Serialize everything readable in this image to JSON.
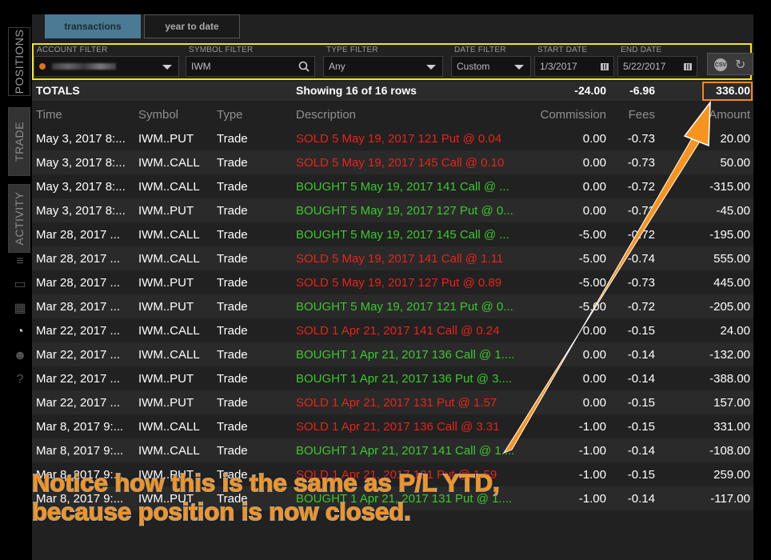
{
  "sidenav": {
    "tabs": [
      {
        "label": "POSITIONS",
        "active": true
      },
      {
        "label": "TRADE",
        "active": false
      },
      {
        "label": "ACTIVITY",
        "active": false
      }
    ],
    "icons": [
      "list-icon",
      "tv-icon",
      "chart-icon",
      "monitor-icon",
      "people-icon",
      "help-icon"
    ]
  },
  "tabs": {
    "transactions": "transactions",
    "ytd": "year to date"
  },
  "filters": {
    "account_label": "ACCOUNT FILTER",
    "symbol_label": "SYMBOL FILTER",
    "symbol_value": "IWM",
    "type_label": "TYPE FILTER",
    "type_value": "Any",
    "date_label": "DATE FILTER",
    "date_value": "Custom",
    "start_label": "START DATE",
    "start_value": "1/3/2017",
    "end_label": "END DATE",
    "end_value": "5/22/2017",
    "csv_label": "CSV"
  },
  "totals": {
    "label": "TOTALS",
    "showing": "Showing 16 of 16 rows",
    "commission": "-24.00",
    "fees": "-6.96",
    "amount": "336.00"
  },
  "columns": {
    "time": "Time",
    "symbol": "Symbol",
    "type": "Type",
    "description": "Description",
    "commission": "Commission",
    "fees": "Fees",
    "amount": "Amount"
  },
  "rows": [
    {
      "time": "May 3, 2017   8:...",
      "symbol": "IWM..PUT",
      "type": "Trade",
      "desc": "SOLD 5 May 19, 2017 121 Put @ 0.04",
      "side": "sold",
      "com": "0.00",
      "fee": "-0.73",
      "amt": "20.00"
    },
    {
      "time": "May 3, 2017   8:...",
      "symbol": "IWM..CALL",
      "type": "Trade",
      "desc": "SOLD 5 May 19, 2017 145 Call @ 0.10",
      "side": "sold",
      "com": "0.00",
      "fee": "-0.73",
      "amt": "50.00"
    },
    {
      "time": "May 3, 2017   8:...",
      "symbol": "IWM..CALL",
      "type": "Trade",
      "desc": "BOUGHT 5 May 19, 2017 141 Call @ ...",
      "side": "bought",
      "com": "0.00",
      "fee": "-0.72",
      "amt": "-315.00"
    },
    {
      "time": "May 3, 2017   8:...",
      "symbol": "IWM..PUT",
      "type": "Trade",
      "desc": "BOUGHT 5 May 19, 2017 127 Put @ 0...",
      "side": "bought",
      "com": "0.00",
      "fee": "-0.72",
      "amt": "-45.00"
    },
    {
      "time": "Mar 28, 2017   ...",
      "symbol": "IWM..CALL",
      "type": "Trade",
      "desc": "BOUGHT 5 May 19, 2017 145 Call @ ...",
      "side": "bought",
      "com": "-5.00",
      "fee": "-0.72",
      "amt": "-195.00"
    },
    {
      "time": "Mar 28, 2017   ...",
      "symbol": "IWM..CALL",
      "type": "Trade",
      "desc": "SOLD 5 May 19, 2017 141 Call @ 1.11",
      "side": "sold",
      "com": "-5.00",
      "fee": "-0.74",
      "amt": "555.00"
    },
    {
      "time": "Mar 28, 2017   ...",
      "symbol": "IWM..PUT",
      "type": "Trade",
      "desc": "SOLD 5 May 19, 2017 127 Put @ 0.89",
      "side": "sold",
      "com": "-5.00",
      "fee": "-0.73",
      "amt": "445.00"
    },
    {
      "time": "Mar 28, 2017   ...",
      "symbol": "IWM..PUT",
      "type": "Trade",
      "desc": "BOUGHT 5 May 19, 2017 121 Put @ 0...",
      "side": "bought",
      "com": "-5.00",
      "fee": "-0.72",
      "amt": "-205.00"
    },
    {
      "time": "Mar 22, 2017   ...",
      "symbol": "IWM..CALL",
      "type": "Trade",
      "desc": "SOLD 1 Apr 21, 2017 141 Call @ 0.24",
      "side": "sold",
      "com": "0.00",
      "fee": "-0.15",
      "amt": "24.00"
    },
    {
      "time": "Mar 22, 2017   ...",
      "symbol": "IWM..CALL",
      "type": "Trade",
      "desc": "BOUGHT 1 Apr 21, 2017 136 Call @ 1....",
      "side": "bought",
      "com": "0.00",
      "fee": "-0.14",
      "amt": "-132.00"
    },
    {
      "time": "Mar 22, 2017   ...",
      "symbol": "IWM..PUT",
      "type": "Trade",
      "desc": "BOUGHT 1 Apr 21, 2017 136 Put @ 3....",
      "side": "bought",
      "com": "0.00",
      "fee": "-0.14",
      "amt": "-388.00"
    },
    {
      "time": "Mar 22, 2017   ...",
      "symbol": "IWM..PUT",
      "type": "Trade",
      "desc": "SOLD 1 Apr 21, 2017 131 Put @ 1.57",
      "side": "sold",
      "com": "0.00",
      "fee": "-0.15",
      "amt": "157.00"
    },
    {
      "time": "Mar 8, 2017   9:...",
      "symbol": "IWM..CALL",
      "type": "Trade",
      "desc": "SOLD 1 Apr 21, 2017 136 Call @ 3.31",
      "side": "sold",
      "com": "-1.00",
      "fee": "-0.15",
      "amt": "331.00"
    },
    {
      "time": "Mar 8, 2017   9:...",
      "symbol": "IWM..CALL",
      "type": "Trade",
      "desc": "BOUGHT 1 Apr 21, 2017 141 Call @ 1....",
      "side": "bought",
      "com": "-1.00",
      "fee": "-0.14",
      "amt": "-108.00"
    },
    {
      "time": "Mar 8, 2017   9:...",
      "symbol": "IWM..PUT",
      "type": "Trade",
      "desc": "SOLD 1 Apr 21, 2017 131 Put @ 1.59",
      "side": "sold",
      "com": "-1.00",
      "fee": "-0.15",
      "amt": "259.00"
    },
    {
      "time": "Mar 8, 2017   9:...",
      "symbol": "IWM..PUT",
      "type": "Trade",
      "desc": "BOUGHT 1 Apr 21, 2017 131 Put @ 1....",
      "side": "bought",
      "com": "-1.00",
      "fee": "-0.14",
      "amt": "-117.00"
    }
  ],
  "annotation": {
    "line1": "Notice how this is the same as P/L YTD,",
    "line2": "because position is now closed."
  },
  "colors": {
    "sold": "#e8231a",
    "bought": "#3cc82c",
    "highlight": "#f5e61a",
    "arrow": "#f7941d",
    "tab_active": "#4b7a94"
  }
}
